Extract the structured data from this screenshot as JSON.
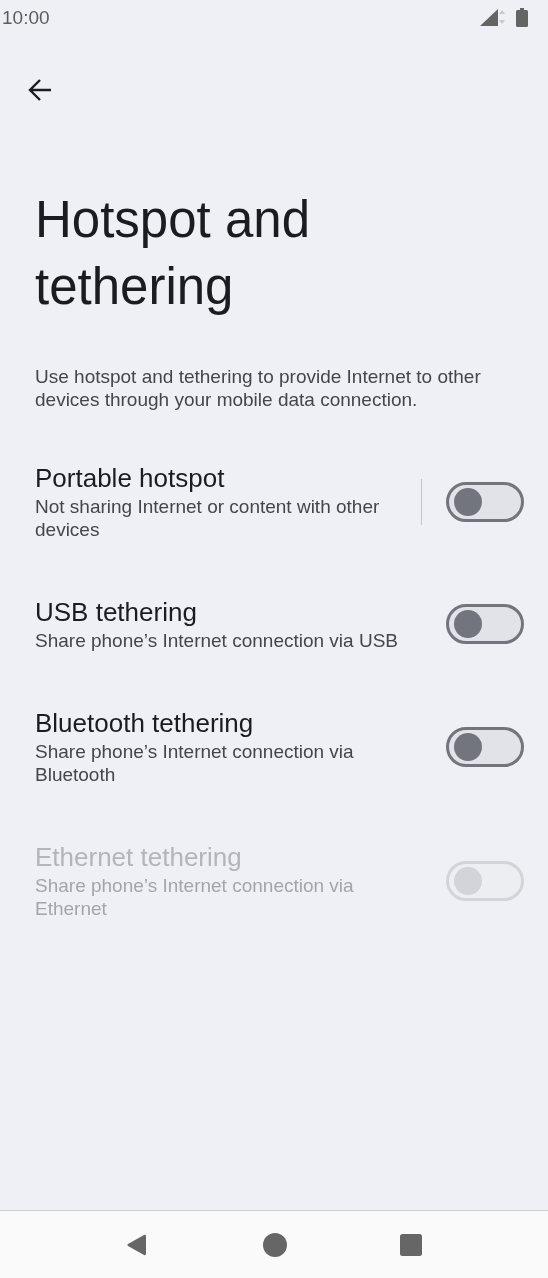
{
  "status_bar": {
    "time": "10:00"
  },
  "title": "Hotspot and tethering",
  "description": "Use hotspot and tethering to provide Internet to other devices through your mobile data connection.",
  "items": [
    {
      "kind": "split",
      "title": "Portable hotspot",
      "subtitle": "Not sharing Internet or content with other devices",
      "on": false,
      "disabled": false
    },
    {
      "kind": "plain",
      "title": "USB tethering",
      "subtitle": "Share phone’s Internet connection via USB",
      "on": false,
      "disabled": false
    },
    {
      "kind": "plain",
      "title": "Bluetooth tethering",
      "subtitle": "Share phone’s Internet connection via Bluetooth",
      "on": false,
      "disabled": false
    },
    {
      "kind": "plain",
      "title": "Ethernet tethering",
      "subtitle": "Share phone’s Internet connection via Ethernet",
      "on": false,
      "disabled": true
    }
  ]
}
